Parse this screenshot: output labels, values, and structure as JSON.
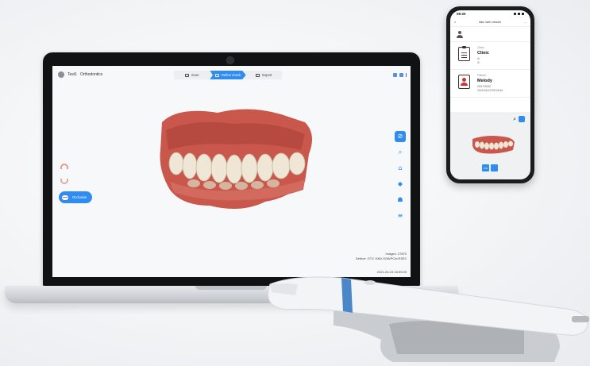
{
  "app": {
    "user_name": "Test1",
    "case_type": "Orthodontics",
    "workflow": [
      "Scan",
      "Refine check",
      "Export"
    ],
    "active_step": 1,
    "occlusion_label": "Occlusion",
    "images_count": "Images: 27870",
    "device_line": "Defirce: GTX 1060-SGB/PCIe/SSE2",
    "timestamp": "2021-02-23 15:59:09"
  },
  "phone": {
    "time": "09:20",
    "title": "3dic web viewer",
    "close": "×",
    "more": "...",
    "clinic": {
      "label": "Clinic",
      "name": "Clinic"
    },
    "patient": {
      "label": "Patient",
      "name": "Melody",
      "dob": "09/17/2000",
      "id": "2021/04/14T09:26:40"
    },
    "bottom_btn_1": "OW"
  },
  "icons": [
    "user-icon",
    "scan-icon",
    "refine-icon",
    "export-icon",
    "upper-jaw-icon",
    "lower-jaw-icon",
    "occlusion-icon",
    "visibility-icon",
    "zoom-icon",
    "measure-icon",
    "shield-icon",
    "teeth-icon",
    "layers-icon",
    "search-icon",
    "clipboard-icon",
    "patient-icon"
  ],
  "colors": {
    "accent": "#2f8cf0",
    "gum": "#c9574c",
    "tooth": "#efe6d6"
  }
}
